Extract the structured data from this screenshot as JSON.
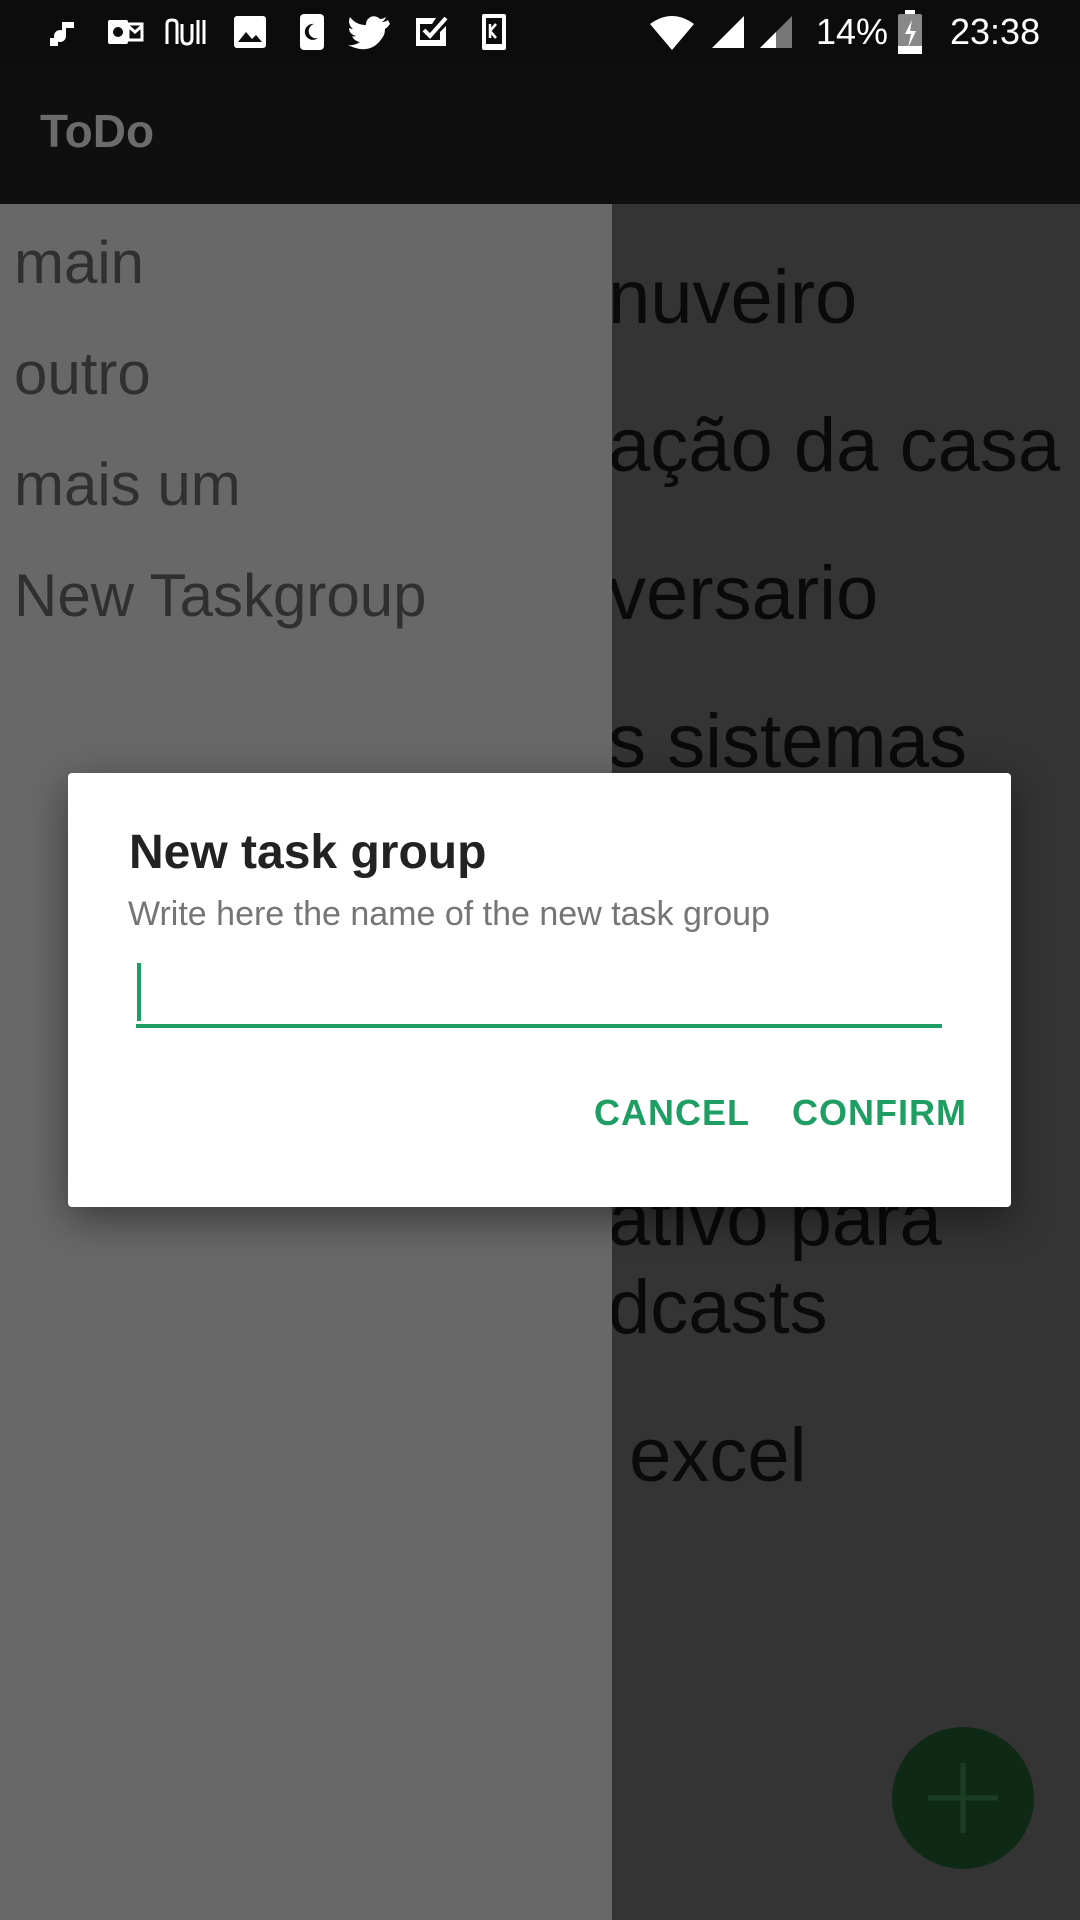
{
  "status_bar": {
    "battery": "14%",
    "time": "23:38",
    "notification_icons": [
      "music-note-icon",
      "outlook-icon",
      "nubank-icon",
      "image-icon",
      "phone-night-icon",
      "twitter-icon",
      "tasks-check-icon",
      "kindle-icon"
    ],
    "system_icons": [
      "wifi-icon",
      "signal-icon",
      "signal-weak-icon",
      "battery-charging-icon"
    ]
  },
  "app_bar": {
    "title": "ToDo"
  },
  "tasks": [
    "nuveiro",
    "ação da casa",
    "versario",
    "s sistemas",
    "ativo para",
    "dcasts",
    " excel"
  ],
  "drawer": {
    "items": [
      "main",
      "outro",
      "mais um",
      "New Taskgroup"
    ]
  },
  "dialog": {
    "title": "New task group",
    "message": "Write here the name of the new task group",
    "input_value": "",
    "cancel_label": "CANCEL",
    "confirm_label": "CONFIRM"
  },
  "fab": {
    "icon": "plus-icon"
  },
  "colors": {
    "accent": "#1e9e63",
    "fab_dimmed": "#0e2a17",
    "drawer": "#686868"
  }
}
